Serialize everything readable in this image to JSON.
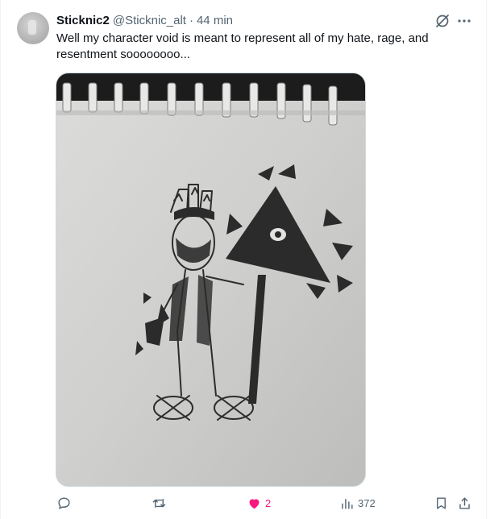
{
  "author": {
    "display_name": "Sticknic2",
    "handle": "@Sticknic_alt",
    "separator": "·",
    "time": "44 min"
  },
  "tweet": {
    "text": "Well my character void is meant to represent all of my hate, rage, and resentment soooooooo..."
  },
  "media": {
    "description_icon": "photo-of-pencil-sketch"
  },
  "actions": {
    "reply_count": "",
    "retweet_count": "",
    "like_count": "2",
    "views_count": "372"
  },
  "colors": {
    "like_active": "#f91880",
    "muted": "#536471",
    "text": "#0f1419"
  },
  "icons": [
    "grok-icon",
    "more-icon",
    "reply-icon",
    "retweet-icon",
    "like-icon",
    "views-icon",
    "bookmark-icon",
    "share-icon"
  ]
}
